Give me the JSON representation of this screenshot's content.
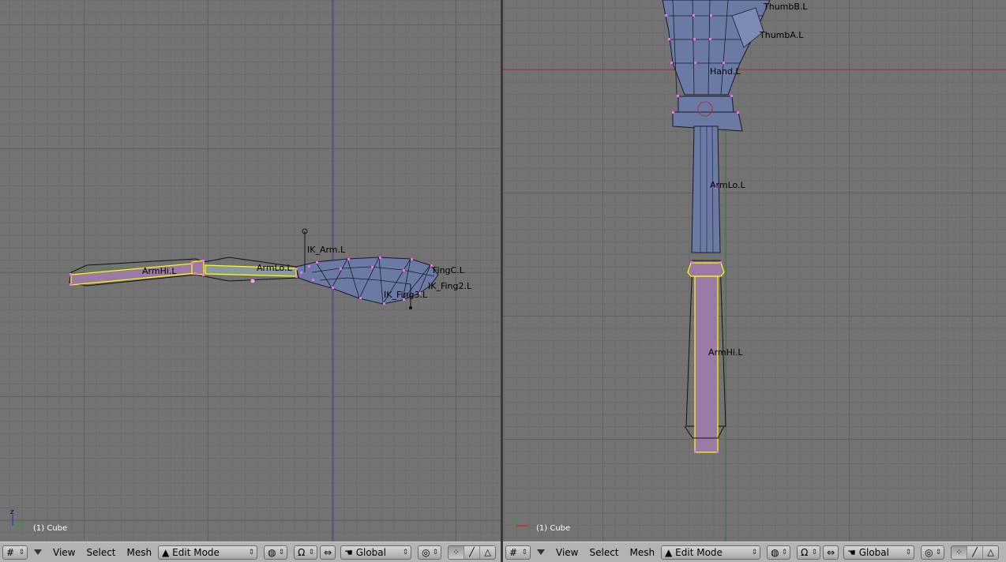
{
  "left_viewport": {
    "object_label": "(1) Cube",
    "bones": [
      {
        "name": "IK_Arm.L"
      },
      {
        "name": "ArmLo.L"
      },
      {
        "name": "ArmHi.L"
      },
      {
        "name": "IK_Fing2.L"
      },
      {
        "name": "IK_Fing3.L"
      },
      {
        "name": "FingC.L"
      }
    ]
  },
  "right_viewport": {
    "object_label": "(1) Cube",
    "bones": [
      {
        "name": "ThumbB.L"
      },
      {
        "name": "ThumbA.L"
      },
      {
        "name": "Hand.L"
      },
      {
        "name": "ArmLo.L"
      },
      {
        "name": "ArmHi.L"
      }
    ]
  },
  "headers": [
    {
      "menus": [
        "View",
        "Select",
        "Mesh"
      ],
      "mode": "Edit Mode",
      "orientation": "Global"
    },
    {
      "menus": [
        "View",
        "Select",
        "Mesh"
      ],
      "mode": "Edit Mode",
      "orientation": "Global"
    }
  ],
  "colors": {
    "grid_bg": "#737373",
    "mesh_fill": "#6a7aa5",
    "selection": "#ffff00",
    "bone_fill": "#9b7aa5",
    "vertex": "#ff66ff",
    "axis_red": "#a33",
    "axis_green": "#3a3",
    "axis_blue": "#33a"
  },
  "icons": {
    "window_type": "grid-icon",
    "draw_type": "cube-icon",
    "snap": "magnet-icon",
    "transform": "hand-icon",
    "pivot": "pivot-icon",
    "select_vertex": "vertex-select-icon",
    "select_edge": "edge-select-icon",
    "select_face": "face-select-icon"
  }
}
